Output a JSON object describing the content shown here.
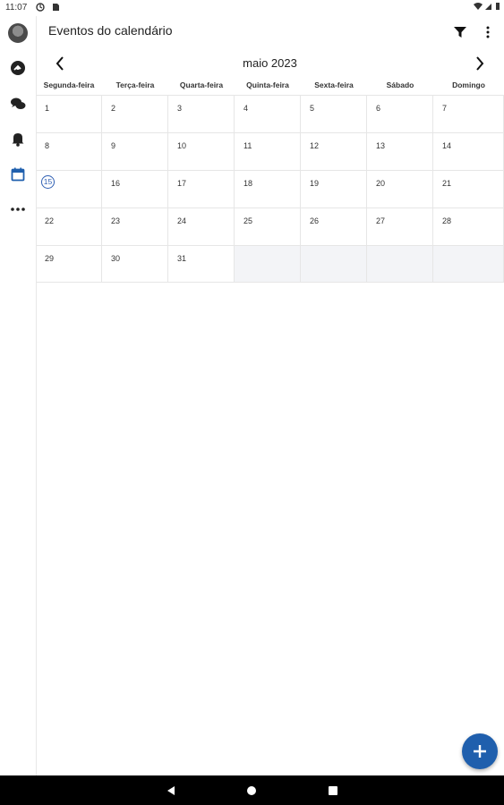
{
  "status_bar": {
    "time": "11:07"
  },
  "app_bar": {
    "title": "Eventos do calendário"
  },
  "calendar": {
    "month_label": "maio 2023",
    "weekdays": [
      "Segunda-feira",
      "Terça-feira",
      "Quarta-feira",
      "Quinta-feira",
      "Sexta-feira",
      "Sábado",
      "Domingo"
    ],
    "weeks": [
      [
        "1",
        "2",
        "3",
        "4",
        "5",
        "6",
        "7"
      ],
      [
        "8",
        "9",
        "10",
        "11",
        "12",
        "13",
        "14"
      ],
      [
        "15",
        "16",
        "17",
        "18",
        "19",
        "20",
        "21"
      ],
      [
        "22",
        "23",
        "24",
        "25",
        "26",
        "27",
        "28"
      ],
      [
        "29",
        "30",
        "31",
        "",
        "",
        "",
        ""
      ]
    ],
    "today": "15"
  },
  "colors": {
    "accent": "#1f5fad",
    "today_ring": "#2f5fb3",
    "empty_cell": "#f3f4f7"
  },
  "icons": {
    "rail": [
      "avatar",
      "dashboard-icon",
      "chat-icon",
      "bell-icon",
      "calendar-icon",
      "more-horizontal-icon"
    ],
    "app_bar": [
      "filter-icon",
      "more-vertical-icon"
    ],
    "fab": "plus-icon"
  }
}
